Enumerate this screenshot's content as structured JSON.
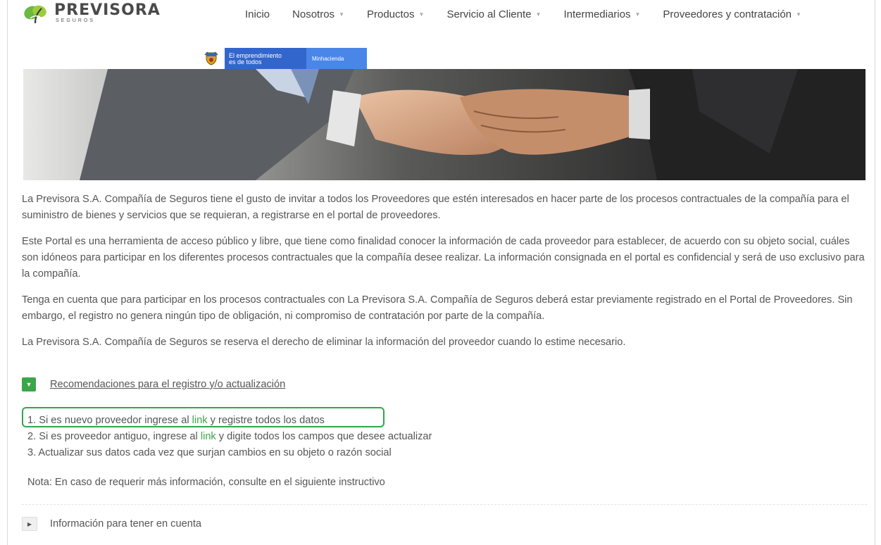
{
  "header": {
    "logo_name": "PREVISORA",
    "logo_sub": "SEGUROS",
    "nav": [
      {
        "label": "Inicio",
        "dropdown": false
      },
      {
        "label": "Nosotros",
        "dropdown": true
      },
      {
        "label": "Productos",
        "dropdown": true
      },
      {
        "label": "Servicio al Cliente",
        "dropdown": true
      },
      {
        "label": "Intermediarios",
        "dropdown": true
      },
      {
        "label": "Proveedores y contratación",
        "dropdown": true
      }
    ],
    "gov_banner": {
      "line1": "El emprendimiento",
      "line2": "es de todos",
      "ministry": "Minhacienda"
    }
  },
  "hero": {
    "icon": "handshake-image"
  },
  "content": {
    "paragraphs": [
      "La Previsora S.A. Compañía de Seguros tiene el gusto de invitar a todos los Proveedores que estén interesados en hacer parte de los procesos contractuales de la compañía para el suministro de bienes y servicios que se requieran, a registrarse en el portal de proveedores.",
      "Este Portal es una herramienta de acceso público y libre, que tiene como finalidad conocer la información de cada proveedor para establecer, de acuerdo con su objeto social, cuáles son idóneos para participar en los diferentes procesos contractuales que la compañía desee realizar. La información consignada en el portal es confidencial y será de uso exclusivo para la compañía.",
      "Tenga en cuenta que para participar en los procesos contractuales con La Previsora S.A. Compañía de Seguros deberá estar previamente registrado en el Portal de Proveedores. Sin embargo, el registro no genera ningún tipo de obligación, ni compromiso de contratación por parte de la compañía.",
      "La Previsora S.A. Compañía de Seguros se reserva el derecho de eliminar la información del proveedor cuando lo estime necesario."
    ]
  },
  "accordion1": {
    "title": "Recomendaciones para el registro y/o actualización",
    "icon": "triangle-down-icon",
    "items": [
      {
        "before": "1. Si es nuevo proveedor ingrese al ",
        "link": "link",
        "after": " y registre todos los datos"
      },
      {
        "before": "2. Si es proveedor antiguo, ingrese al ",
        "link": "link",
        "after": " y digite todos los campos que desee actualizar"
      },
      {
        "before": "3. Actualizar sus datos cada vez que surjan cambios en su objeto o razón social",
        "link": "",
        "after": ""
      }
    ],
    "note": "Nota: En caso de requerir más información, consulte en el siguiente instructivo"
  },
  "accordion2": {
    "title": "Información para tener en cuenta",
    "icon": "triangle-right-icon"
  },
  "colors": {
    "accent_green": "#3aa64a",
    "highlight_border": "#2ea84a",
    "gov_blue": "#3366cc"
  }
}
